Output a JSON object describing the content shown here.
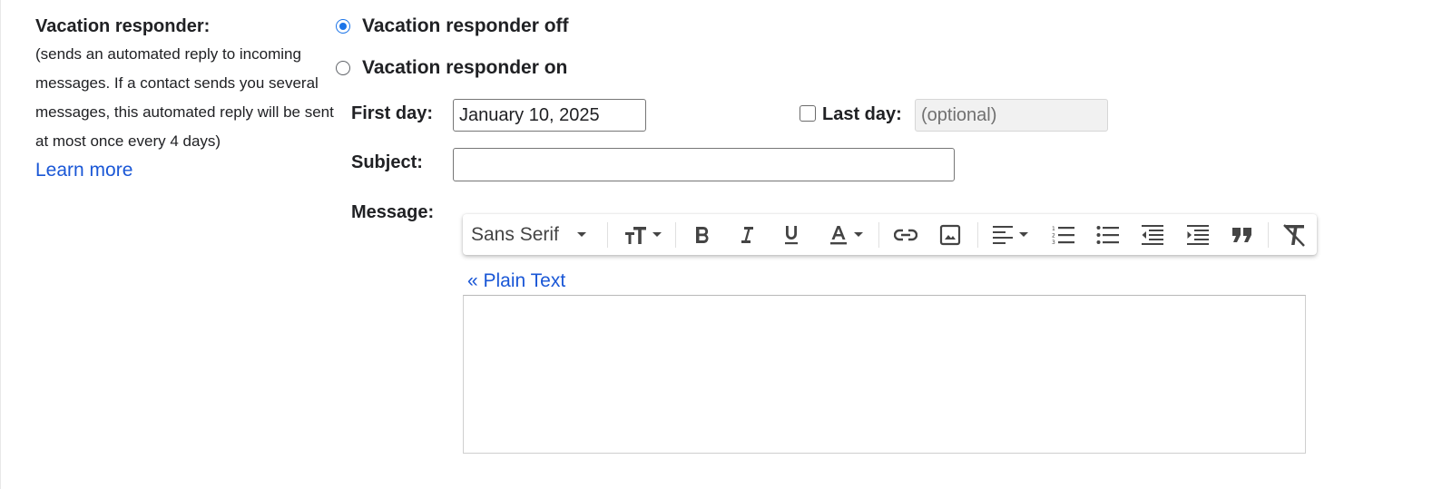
{
  "vacation": {
    "title": "Vacation responder:",
    "description": "(sends an automated reply to incoming messages. If a contact sends you several messages, this automated reply will be sent at most once every 4 days)",
    "learn_more": "Learn more",
    "option_off": "Vacation responder off",
    "option_on": "Vacation responder on",
    "selected": "off",
    "first_day_label": "First day:",
    "first_day_value": "January 10, 2025",
    "last_day_label": "Last day:",
    "last_day_placeholder": "(optional)",
    "last_day_checked": false,
    "subject_label": "Subject:",
    "subject_value": "",
    "message_label": "Message:",
    "plain_text_link": "« Plain Text",
    "message_value": ""
  },
  "toolbar": {
    "font": "Sans Serif",
    "icons": [
      "font-size-icon",
      "bold-icon",
      "italic-icon",
      "underline-icon",
      "text-color-icon",
      "link-icon",
      "image-icon",
      "align-icon",
      "numbered-list-icon",
      "bulleted-list-icon",
      "indent-less-icon",
      "indent-more-icon",
      "quote-icon",
      "remove-formatting-icon"
    ]
  },
  "colors": {
    "accent": "#1a73e8",
    "link": "#1a57d6"
  }
}
